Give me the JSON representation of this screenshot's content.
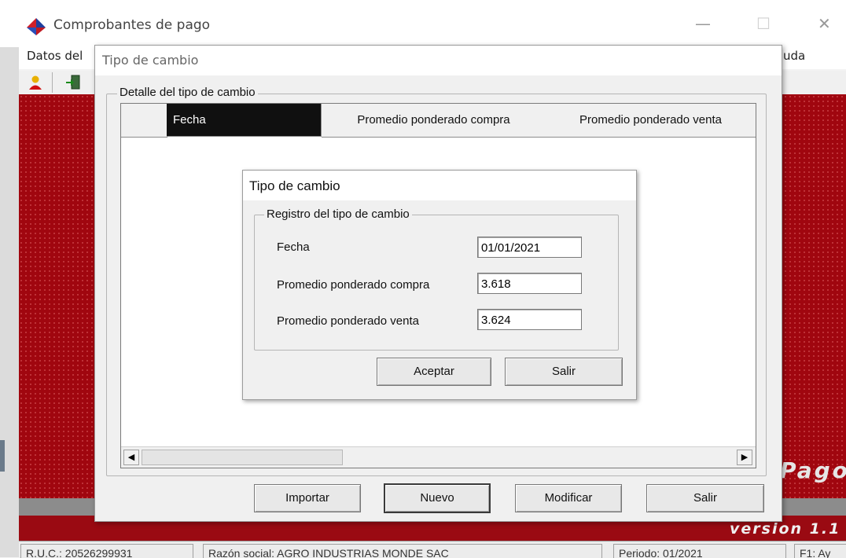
{
  "main_window": {
    "title": "Comprobantes de pago",
    "window_controls": {
      "minimize": "—",
      "maximize": "☐",
      "close": "✕"
    },
    "menubar": {
      "left_item": "Datos del",
      "right_item": "uda"
    },
    "toolbar_icons": [
      "user-icon",
      "exit-door-icon"
    ],
    "banner_text": "Pago",
    "version_text": "version 1.1",
    "statusbar": [
      "R.U.C.: 20526299931",
      "Razón social: AGRO INDUSTRIAS MONDE SAC",
      "Periodo: 01/2021",
      "F1: Ay"
    ],
    "colors": {
      "accent_red": "#a0060f",
      "dialog_bg": "#f0f0f0"
    }
  },
  "outer_dialog": {
    "title": "Tipo de cambio",
    "group_label": "Detalle del tipo de cambio",
    "grid_columns": [
      "",
      "Fecha",
      "Promedio ponderado compra",
      "Promedio ponderado venta"
    ],
    "grid_rows": [],
    "buttons": {
      "import": "Importar",
      "new": "Nuevo",
      "modify": "Modificar",
      "exit": "Salir"
    }
  },
  "inner_dialog": {
    "title": "Tipo de cambio",
    "group_label": "Registro del tipo de cambio",
    "fields": {
      "fecha_label": "Fecha",
      "fecha_value": "01/01/2021",
      "compra_label": "Promedio ponderado compra",
      "compra_value": "3.618",
      "venta_label": "Promedio ponderado venta",
      "venta_value": "3.624"
    },
    "buttons": {
      "accept": "Aceptar",
      "exit": "Salir"
    }
  }
}
